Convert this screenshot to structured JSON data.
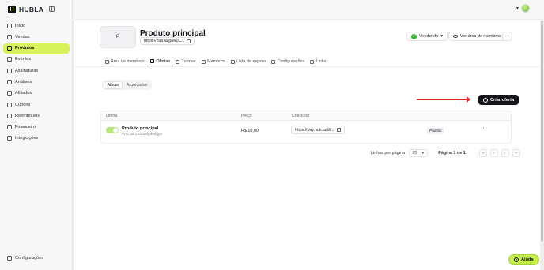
{
  "brand": {
    "name": "HUBLA",
    "logo_letter": "H"
  },
  "sidebar": {
    "items": [
      {
        "label": "Início",
        "icon": "home-icon"
      },
      {
        "label": "Vendas",
        "icon": "cart-icon"
      },
      {
        "label": "Produtos",
        "icon": "box-icon",
        "active": true
      },
      {
        "label": "Eventos",
        "icon": "calendar-icon"
      },
      {
        "label": "Assinaturas",
        "icon": "refresh-icon"
      },
      {
        "label": "Análises",
        "icon": "chart-icon"
      },
      {
        "label": "Afiliados",
        "icon": "users-icon"
      },
      {
        "label": "Cupons",
        "icon": "ticket-icon"
      },
      {
        "label": "Reembolsos",
        "icon": "refund-icon"
      },
      {
        "label": "Financeiro",
        "icon": "wallet-icon"
      },
      {
        "label": "Integrações",
        "icon": "plug-icon"
      }
    ],
    "settings": {
      "label": "Configurações",
      "icon": "gear-icon"
    }
  },
  "header": {
    "chevron": "▾"
  },
  "product": {
    "thumb_letter": "P",
    "title": "Produto principal",
    "url": "https://hub.la/g/W1C...",
    "status_label": "Vendendo",
    "members_label": "Ver área de membros",
    "more": "···"
  },
  "tabs": [
    {
      "label": "Área de membros",
      "icon": "layout-icon"
    },
    {
      "label": "Ofertas",
      "icon": "tag-icon",
      "active": true
    },
    {
      "label": "Turmas",
      "icon": "grid-icon"
    },
    {
      "label": "Membros",
      "icon": "users-icon"
    },
    {
      "label": "Lista de espera",
      "icon": "list-icon"
    },
    {
      "label": "Configurações",
      "icon": "gear-icon"
    },
    {
      "label": "Links",
      "icon": "link-icon"
    }
  ],
  "filter": {
    "active_label": "Ativas",
    "archived_label": "Arquivadas"
  },
  "create_offer_label": "Criar oferta",
  "table": {
    "headers": {
      "offer": "Oferta",
      "price": "Preço",
      "checkout": "Checkout"
    },
    "rows": [
      {
        "name": "Produto principal",
        "id": "W1CWrCkt2Ibi0pbvfgpn",
        "price": "R$ 10,00",
        "checkout": "https://pay.hub.la/W...",
        "badge": "Padrão",
        "more": "···",
        "enabled": true
      }
    ]
  },
  "pagination": {
    "rows_per_page_label": "Linhas por página",
    "rows_per_page": "25",
    "page_info": "Página 1 de 1",
    "first": "«",
    "prev": "‹",
    "next": "›",
    "last": "»"
  },
  "help_label": "Ajuda",
  "colors": {
    "accent": "#d7f25a",
    "primary_button": "#141518",
    "arrow": "#e02424",
    "status_ok": "#2eb82e"
  }
}
